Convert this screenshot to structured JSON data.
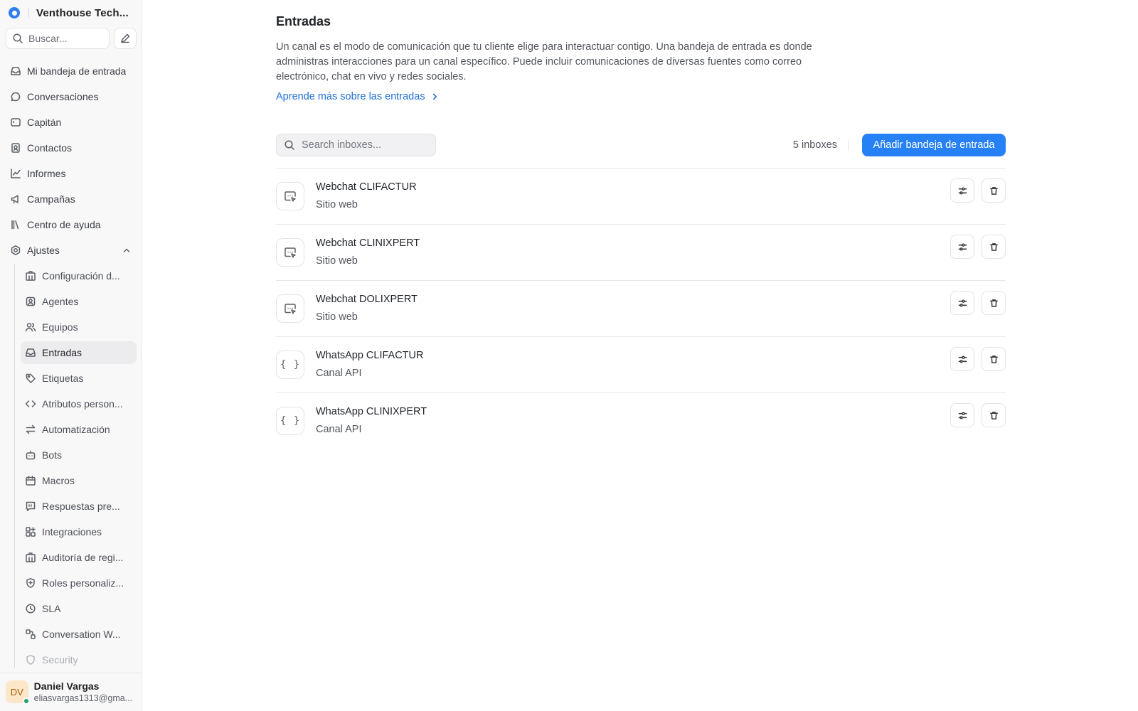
{
  "brand": {
    "name": "Venthouse Tech..."
  },
  "sidebar": {
    "search_placeholder": "Buscar...",
    "items": [
      {
        "label": "Mi bandeja de entrada",
        "icon": "inbox-icon"
      },
      {
        "label": "Conversaciones",
        "icon": "chat-bubble-icon"
      },
      {
        "label": "Capitán",
        "icon": "captain-icon"
      },
      {
        "label": "Contactos",
        "icon": "contacts-icon"
      },
      {
        "label": "Informes",
        "icon": "chart-line-icon"
      },
      {
        "label": "Campañas",
        "icon": "megaphone-icon"
      },
      {
        "label": "Centro de ayuda",
        "icon": "library-icon"
      }
    ],
    "settings": {
      "label": "Ajustes",
      "icon": "gear-icon",
      "children": [
        {
          "label": "Configuración d...",
          "icon": "building-icon"
        },
        {
          "label": "Agentes",
          "icon": "agent-icon"
        },
        {
          "label": "Equipos",
          "icon": "team-icon"
        },
        {
          "label": "Entradas",
          "icon": "inbox-icon"
        },
        {
          "label": "Etiquetas",
          "icon": "tag-icon"
        },
        {
          "label": "Atributos person...",
          "icon": "code-icon"
        },
        {
          "label": "Automatización",
          "icon": "swap-icon"
        },
        {
          "label": "Bots",
          "icon": "bot-icon"
        },
        {
          "label": "Macros",
          "icon": "calendar-icon"
        },
        {
          "label": "Respuestas pre...",
          "icon": "quote-icon"
        },
        {
          "label": "Integraciones",
          "icon": "apps-icon"
        },
        {
          "label": "Auditoría de regi...",
          "icon": "building-icon"
        },
        {
          "label": "Roles personaliz...",
          "icon": "shield-icon"
        },
        {
          "label": "SLA",
          "icon": "clock-icon"
        },
        {
          "label": "Conversation W...",
          "icon": "workflow-icon"
        },
        {
          "label": "Security",
          "icon": "shield-icon"
        }
      ]
    }
  },
  "user": {
    "initials": "DV",
    "name": "Daniel Vargas",
    "email": "eliasvargas1313@gma..."
  },
  "page": {
    "title": "Entradas",
    "description": "Un canal es el modo de comunicación que tu cliente elige para interactuar contigo. Una bandeja de entrada es donde administras interacciones para un canal específico. Puede incluir comunicaciones de diversas fuentes como correo electrónico, chat en vivo y redes sociales.",
    "learn_more": "Aprende más sobre las entradas",
    "search_placeholder": "Search inboxes...",
    "count": "5 inboxes",
    "add_button": "Añadir bandeja de entrada"
  },
  "inboxes": [
    {
      "name": "Webchat CLIFACTUR",
      "type": "Sitio web",
      "icon": "website-icon"
    },
    {
      "name": "Webchat CLINIXPERT",
      "type": "Sitio web",
      "icon": "website-icon"
    },
    {
      "name": "Webchat DOLIXPERT",
      "type": "Sitio web",
      "icon": "website-icon"
    },
    {
      "name": "WhatsApp CLIFACTUR",
      "type": "Canal API",
      "icon": "braces-icon"
    },
    {
      "name": "WhatsApp CLINIXPERT",
      "type": "Canal API",
      "icon": "braces-icon"
    }
  ],
  "colors": {
    "accent": "#2781f6",
    "link": "#1f6fd6",
    "active_bg": "#ececef"
  }
}
